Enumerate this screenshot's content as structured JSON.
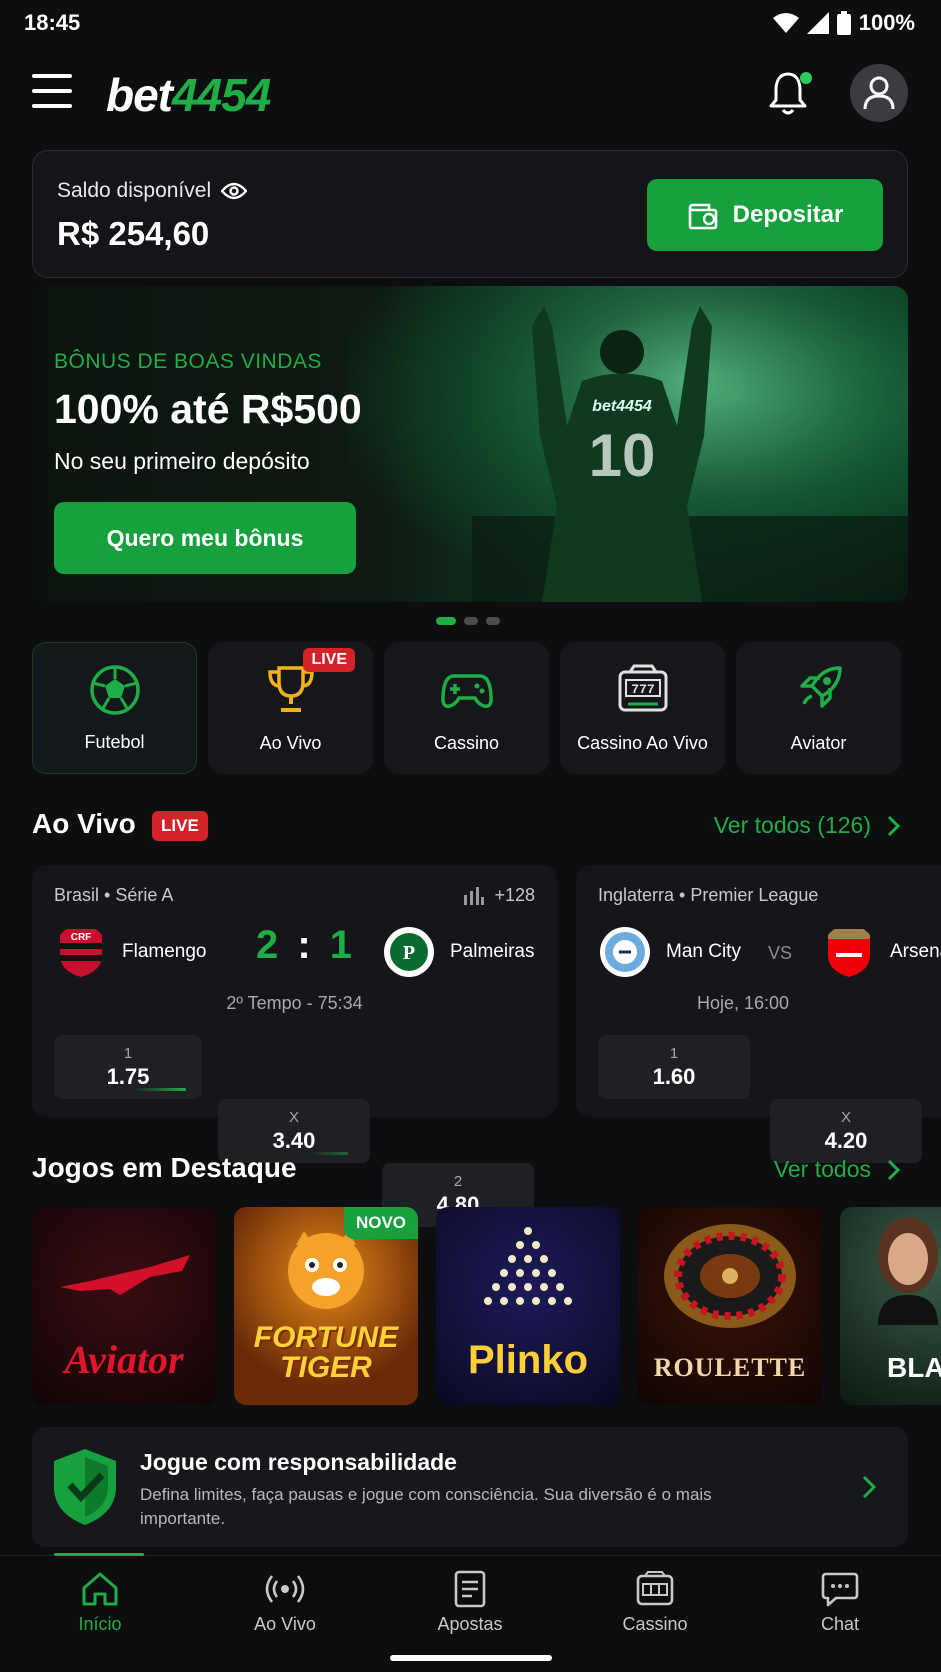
{
  "status_bar": {
    "time": "18:45",
    "battery": "100%"
  },
  "header": {
    "logo_left": "bet",
    "logo_right": "4454"
  },
  "balance": {
    "label": "Saldo disponível",
    "value": "R$ 254,60",
    "deposit_label": "Depositar"
  },
  "banner": {
    "tag": "BÔNUS DE BOAS VINDAS",
    "title": "100% até R$500",
    "subtitle": "No seu primeiro depósito",
    "cta": "Quero meu bônus",
    "jersey_text": "bet4454",
    "jersey_number": "10",
    "slides": 3,
    "active_slide": 1
  },
  "categories": [
    {
      "label": "Futebol",
      "icon": "soccer-ball-icon",
      "active": true
    },
    {
      "label": "Ao Vivo",
      "icon": "trophy-icon",
      "badge": "LIVE"
    },
    {
      "label": "Cassino",
      "icon": "gamepad-icon"
    },
    {
      "label": "Cassino Ao Vivo",
      "icon": "slot-machine-icon"
    },
    {
      "label": "Aviator",
      "icon": "rocket-icon"
    }
  ],
  "live_section": {
    "title": "Ao Vivo",
    "badge": "LIVE",
    "see_all": "Ver todos (126)"
  },
  "matches": [
    {
      "league": "Brasil • Série A",
      "markets": "+128",
      "home": "Flamengo",
      "away": "Palmeiras",
      "score_home": "2",
      "score_away": "1",
      "time": "2º Tempo - 75:34",
      "odds": [
        {
          "k": "1",
          "v": "1.75"
        },
        {
          "k": "X",
          "v": "3.40"
        },
        {
          "k": "2",
          "v": "4.80"
        }
      ]
    },
    {
      "league": "Inglaterra • Premier League",
      "home": "Man City",
      "away": "Arsenal",
      "vs": "VS",
      "time": "Hoje, 16:00",
      "odds": [
        {
          "k": "1",
          "v": "1.60"
        },
        {
          "k": "X",
          "v": "4.20"
        }
      ]
    }
  ],
  "featured": {
    "title": "Jogos em Destaque",
    "see_all": "Ver todos",
    "games": [
      {
        "name": "Aviator"
      },
      {
        "name": "FORTUNE TIGER",
        "badge": "NOVO"
      },
      {
        "name": "Plinko"
      },
      {
        "name": "ROULETTE"
      },
      {
        "name": "BLACKJACK"
      }
    ]
  },
  "responsible": {
    "title": "Jogue com responsabilidade",
    "text": "Defina limites, faça pausas e jogue com consciência. Sua diversão é o mais importante."
  },
  "bottom_nav": [
    {
      "label": "Início",
      "icon": "home-icon",
      "active": true
    },
    {
      "label": "Ao Vivo",
      "icon": "broadcast-icon"
    },
    {
      "label": "Apostas",
      "icon": "betslip-icon"
    },
    {
      "label": "Cassino",
      "icon": "casino-icon"
    },
    {
      "label": "Chat",
      "icon": "chat-icon"
    }
  ],
  "colors": {
    "accent": "#1fae45",
    "button": "#16a13e",
    "live": "#d3222a",
    "background": "#0d0e10"
  }
}
